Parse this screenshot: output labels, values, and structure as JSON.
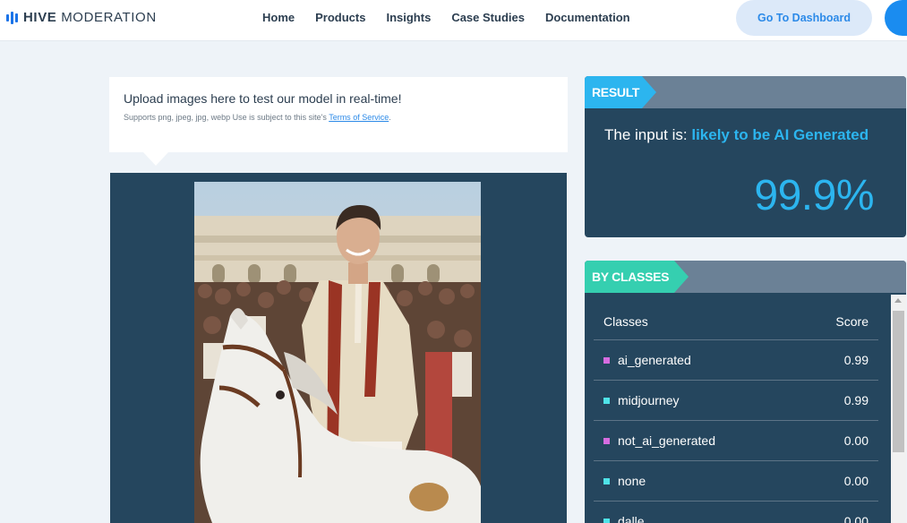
{
  "header": {
    "logo_bold": "HIVE",
    "logo_light": "MODERATION",
    "nav": [
      "Home",
      "Products",
      "Insights",
      "Case Studies",
      "Documentation"
    ],
    "dashboard_button": "Go To Dashboard"
  },
  "upload": {
    "title": "Upload images here to test our model in real-time!",
    "subtitle": "Supports png, jpeg, jpg, webp Use is subject to this site's",
    "terms_link": "Terms of Service",
    "terms_suffix": "."
  },
  "result": {
    "tag": "RESULT",
    "prefix": "The input is:",
    "verdict": "likely to be AI Generated",
    "percentage": "99.9%"
  },
  "classes": {
    "tag": "BY CLASSES",
    "header": {
      "name": "Classes",
      "score": "Score"
    },
    "rows": [
      {
        "name": "ai_generated",
        "score": "0.99",
        "color": "#d66ce0"
      },
      {
        "name": "midjourney",
        "score": "0.99",
        "color": "#4fe3e8"
      },
      {
        "name": "not_ai_generated",
        "score": "0.00",
        "color": "#d66ce0"
      },
      {
        "name": "none",
        "score": "0.00",
        "color": "#4fe3e8"
      },
      {
        "name": "dalle",
        "score": "0.00",
        "color": "#4fe3e8"
      }
    ]
  },
  "colors": {
    "accent": "#2cb5ef",
    "panel": "#25465e",
    "classes_tag": "#35cfb0"
  }
}
